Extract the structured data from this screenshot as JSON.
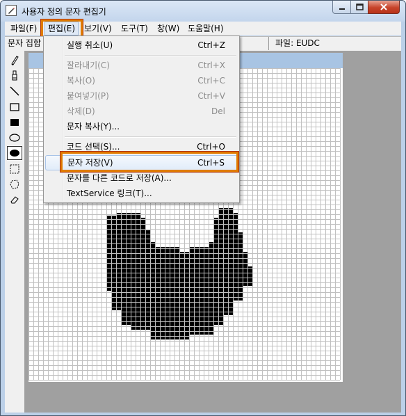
{
  "window": {
    "title": "사용자 정의 문자 편집기",
    "controls": {
      "minimize": "─",
      "maximize": "☐",
      "close": "✕"
    }
  },
  "menubar": {
    "items": [
      {
        "label": "파일(F)"
      },
      {
        "label": "편집(E)"
      },
      {
        "label": "보기(V)"
      },
      {
        "label": "도구(T)"
      },
      {
        "label": "창(W)"
      },
      {
        "label": "도움말(H)"
      }
    ]
  },
  "infobar": {
    "charset_label": "문자 집합",
    "file_label": "파일: EUDC"
  },
  "toolbox": {
    "tools": [
      "pencil-icon",
      "brush-icon",
      "line-icon",
      "hollow-rectangle-icon",
      "filled-rectangle-icon",
      "hollow-ellipse-icon",
      "filled-ellipse-icon",
      "rect-select-icon",
      "freeform-select-icon",
      "eraser-icon"
    ],
    "selected": "filled-ellipse-icon"
  },
  "edit_menu": {
    "items": [
      {
        "label": "실행 취소(U)",
        "shortcut": "Ctrl+Z",
        "enabled": true
      },
      {
        "label": "잘라내기(C)",
        "shortcut": "Ctrl+X",
        "enabled": false
      },
      {
        "label": "복사(O)",
        "shortcut": "Ctrl+C",
        "enabled": false
      },
      {
        "label": "붙여넣기(P)",
        "shortcut": "Ctrl+V",
        "enabled": false
      },
      {
        "label": "삭제(D)",
        "shortcut": "Del",
        "enabled": false
      },
      {
        "label": "문자 복사(Y)...",
        "shortcut": "",
        "enabled": true
      },
      {
        "label": "코드 선택(S)...",
        "shortcut": "Ctrl+O",
        "enabled": true
      },
      {
        "label": "문자 저장(V)",
        "shortcut": "Ctrl+S",
        "enabled": true
      },
      {
        "label": "문자를 다른 코드로 저장(A)...",
        "shortcut": "",
        "enabled": true
      },
      {
        "label": "TextService 링크(T)...",
        "shortcut": "",
        "enabled": true
      }
    ]
  },
  "highlight_color": "#e07b00",
  "grid_color": "#c0c0c0"
}
